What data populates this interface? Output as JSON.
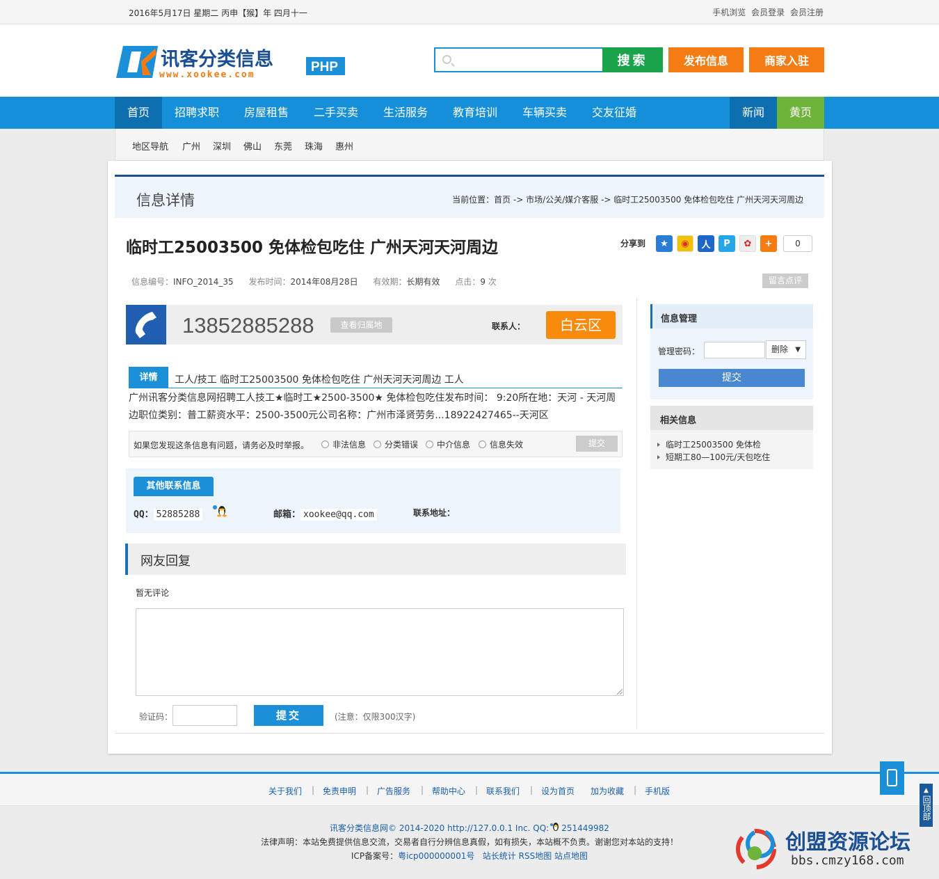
{
  "topbar": {
    "date": "2016年5月17日 星期二  丙申【猴】年 四月十一",
    "links": [
      "手机浏览",
      "会员登录",
      "会员注册"
    ]
  },
  "header": {
    "logo_text": "讯客分类信息",
    "logo_url": "www.xookee.com",
    "logo_badge": "PHP",
    "search_placeholder": "",
    "search_btn": "搜索",
    "post_btn": "发布信息",
    "biz_btn": "商家入驻"
  },
  "nav": {
    "items": [
      "首页",
      "招聘求职",
      "房屋租售",
      "二手买卖",
      "生活服务",
      "教育培训",
      "车辆买卖",
      "交友征婚"
    ],
    "news": "新闻",
    "yellow": "黄页",
    "active_color": "#0d6fb0",
    "yellow_color": "#6fb43a"
  },
  "subnav": {
    "label": "地区导航",
    "cities": [
      "广州",
      "深圳",
      "佛山",
      "东莞",
      "珠海",
      "惠州"
    ]
  },
  "titlebar": {
    "heading": "信息详情",
    "crumb": "当前位置：首页 -> 市场/公关/媒介客服 -> 临时工25003500 免体检包吃住 广州天河天河周边"
  },
  "post": {
    "title": "临时工25003500 免体检包吃住 广州天河天河周边",
    "share_label": "分享到",
    "share_count": "0",
    "meta": {
      "id_label": "信息编号：",
      "id": "INFO_2014_35",
      "time_label": "发布时间：",
      "time": "2014年08月28日",
      "valid_label": "有效期：",
      "valid": "长期有效",
      "click_label": "点击：",
      "clicks": "9",
      "click_unit": "次"
    },
    "comment_btn": "留言点评",
    "phone": "13852885288",
    "attr_btn": "查看归属地",
    "contact_label": "联系人：",
    "area": "白云区",
    "detail_tag": "详情",
    "detail_cat": "工人/技工 临时工25003500 免体检包吃住 广州天河天河周边 工人",
    "detail_body": "广州讯客分类信息网招聘工人技工★临时工★2500-3500★ 免体检包吃住发布时间： 9:20所在地：天河 - 天河周边职位类别：普工薪资水平：2500-3500元公司名称：广州市泽贤劳务...18922427465--天河区",
    "report_text": "如果您发现这条信息有问题，请务必及时举报。",
    "report_opts": [
      "非法信息",
      "分类错误",
      "中介信息",
      "信息失效"
    ],
    "report_btn": "提交",
    "other_tag": "其他联系信息",
    "qq_label": "QQ：",
    "qq": "52885288",
    "mail_label": "邮箱：",
    "mail": "xookee@qq.com",
    "addr_label": "联系地址："
  },
  "reply": {
    "heading": "网友回复",
    "empty": "暂无评论",
    "textarea_value": "",
    "code_label": "验证码：",
    "submit": "提交",
    "note": "(注意：仅限300汉字)"
  },
  "sidebar": {
    "mgr_title": "信息管理",
    "pw_label": "管理密码：",
    "select_value": "删除",
    "mgr_submit": "提交",
    "rel_title": "相关信息",
    "rel_items": [
      "临时工25003500 免体检",
      "短期工80—100元/天包吃住"
    ]
  },
  "footer": {
    "links": [
      "关于我们",
      "免责申明",
      "广告服务",
      "帮助中心",
      "联系我们",
      "设为首页",
      "加为收藏",
      "手机版"
    ],
    "copy1": "讯客分类信息网© 2014-2020 http://127.0.0.1 Inc. QQ:",
    "copy1_qq": "251449982",
    "copy2": "法律声明：本站免费提供信息交流，交易者自行分辨信息真假，如有损失，本站概不负责。谢谢您对本站的支持！",
    "copy3_prefix": "ICP备案号：",
    "copy3_links": [
      "粤icp000000001号",
      "站长统计",
      "RSS地图",
      "站点地图"
    ],
    "backtop": "回顶部"
  },
  "watermark": {
    "title": "创盟资源论坛",
    "url": "bbs.cmzy168.com"
  }
}
